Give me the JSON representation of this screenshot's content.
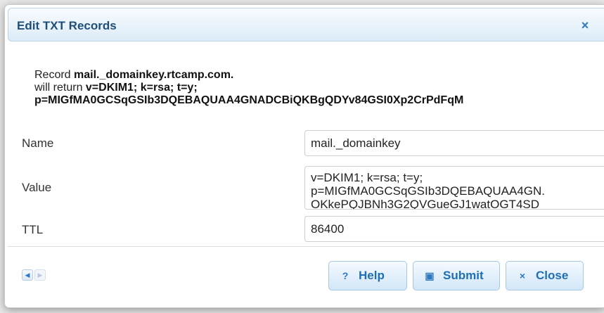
{
  "dialog": {
    "title": "Edit TXT Records",
    "close_glyph": "×"
  },
  "description": {
    "prefix1": "Record ",
    "record_name": "mail._domainkey.rtcamp.com.",
    "prefix2": "will return ",
    "returns": "v=DKIM1; k=rsa; t=y;",
    "public_key": "p=MIGfMA0GCSqGSIb3DQEBAQUAA4GNADCBiQKBgQDYv84GSI0Xp2CrPdFqM"
  },
  "form": {
    "name_label": "Name",
    "name_value": "mail._domainkey",
    "value_label": "Value",
    "value_lines": [
      "v=DKIM1; k=rsa; t=y;",
      "p=MIGfMA0GCSqGSIb3DQEBAQUAA4GN.",
      "OKkePQJBNh3G2QVGueGJ1watOGT4SD"
    ],
    "ttl_label": "TTL",
    "ttl_value": "86400"
  },
  "pager": {
    "prev_icon": "triangle-left-icon",
    "next_icon": "triangle-right-icon"
  },
  "buttons": {
    "help": {
      "icon": "?",
      "label": "Help"
    },
    "submit": {
      "icon": "▣",
      "label": "Submit"
    },
    "close": {
      "icon": "×",
      "label": "Close"
    }
  },
  "colors": {
    "title_text": "#1f4e79",
    "accent": "#2f79bf"
  }
}
